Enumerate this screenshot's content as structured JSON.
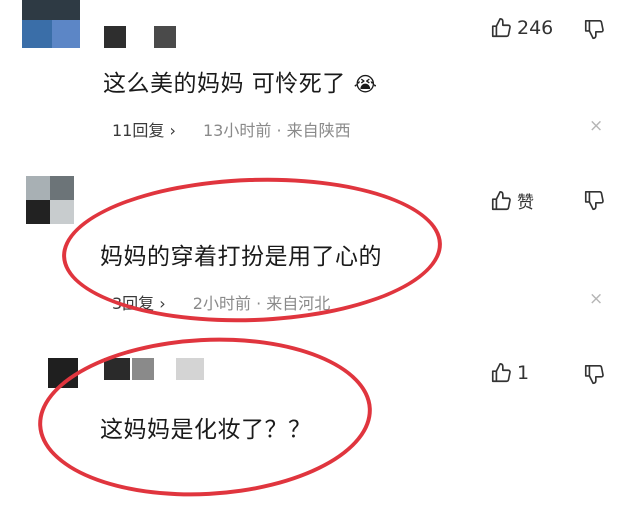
{
  "comments": [
    {
      "text": "这么美的妈妈 可怜死了",
      "emoji": "😭",
      "replies": "11回复",
      "time": "13小时前",
      "location": "来自陕西",
      "likes": "246",
      "close": "×"
    },
    {
      "text": "妈妈的穿着打扮是用了心的",
      "replies": "3回复",
      "time": "2小时前",
      "location": "来自河北",
      "likes": "赞",
      "close": "×"
    },
    {
      "text": "这妈妈是化妆了？？",
      "likes": "1"
    }
  ],
  "separator": "·",
  "chevron": "›",
  "annotation_color": "#e0353e"
}
